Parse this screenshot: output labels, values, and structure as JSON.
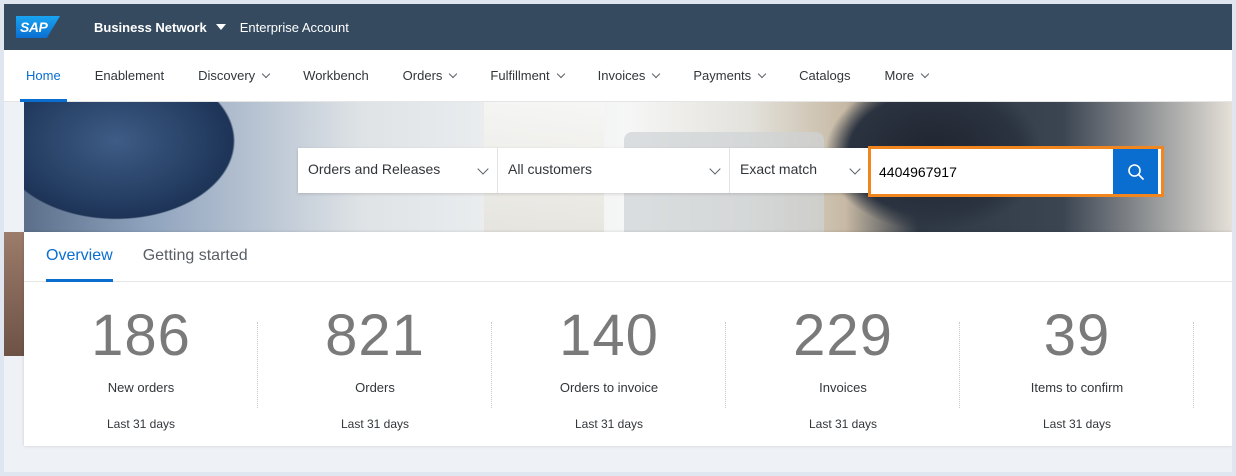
{
  "shellbar": {
    "logo": "SAP",
    "title": "Business Network",
    "account": "Enterprise Account",
    "bg_color": "#354a5f"
  },
  "nav": {
    "items": [
      {
        "label": "Home",
        "active": true,
        "dropdown": false
      },
      {
        "label": "Enablement",
        "dropdown": false
      },
      {
        "label": "Discovery",
        "dropdown": true
      },
      {
        "label": "Workbench",
        "dropdown": false
      },
      {
        "label": "Orders",
        "dropdown": true
      },
      {
        "label": "Fulfillment",
        "dropdown": true
      },
      {
        "label": "Invoices",
        "dropdown": true
      },
      {
        "label": "Payments",
        "dropdown": true
      },
      {
        "label": "Catalogs",
        "dropdown": false
      },
      {
        "label": "More",
        "dropdown": true
      }
    ],
    "accent": "#0a6ed1"
  },
  "search": {
    "doc_type": "Orders and Releases",
    "customers": "All customers",
    "match": "Exact match",
    "query": "4404967917",
    "highlight_color": "#f0861d"
  },
  "tabs": [
    {
      "label": "Overview",
      "active": true
    },
    {
      "label": "Getting started",
      "active": false
    }
  ],
  "stats": [
    {
      "value": "186",
      "label": "New orders",
      "period": "Last 31 days"
    },
    {
      "value": "821",
      "label": "Orders",
      "period": "Last 31 days"
    },
    {
      "value": "140",
      "label": "Orders to invoice",
      "period": "Last 31 days"
    },
    {
      "value": "229",
      "label": "Invoices",
      "period": "Last 31 days"
    },
    {
      "value": "39",
      "label": "Items to confirm",
      "period": "Last 31 days"
    }
  ]
}
